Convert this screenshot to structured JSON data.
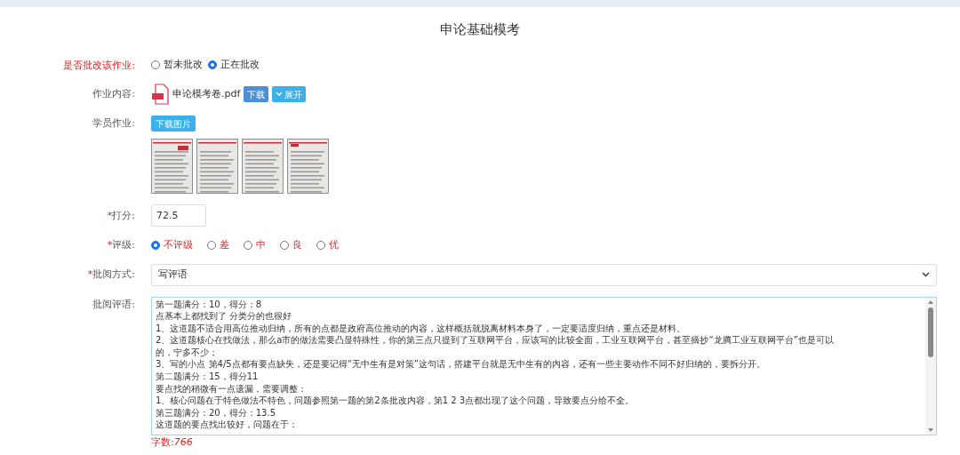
{
  "title": "申论基础模考",
  "grading_status": {
    "label": "是否批改该作业:",
    "emphasized": true,
    "options": [
      {
        "label": "暂未批改",
        "selected": false
      },
      {
        "label": "正在批改",
        "selected": true
      }
    ]
  },
  "assignment": {
    "label": "作业内容:",
    "file_name": "申论模考卷.pdf",
    "download_button": "下载",
    "expand_button": "展开"
  },
  "student_work": {
    "label": "学员作业:",
    "download_button": "下载图片"
  },
  "score": {
    "required_mark": "*",
    "label": "打分:",
    "value": "72.5"
  },
  "rating": {
    "required_mark": "*",
    "label": "评级:",
    "options": [
      {
        "label": "不评级",
        "selected": true
      },
      {
        "label": "差",
        "selected": false
      },
      {
        "label": "中",
        "selected": false
      },
      {
        "label": "良",
        "selected": false
      },
      {
        "label": "优",
        "selected": false
      }
    ]
  },
  "review_method": {
    "required_mark": "*",
    "label": "批阅方式:",
    "value": "写评语"
  },
  "comment": {
    "label": "批阅评语:",
    "lines": [
      "第一题满分：10，得分：8",
      "点基本上都找到了 分类分的也很好",
      "1、这道题不适合用高位推动归纳，所有的点都是政府高位推动的内容，这样概括就脱离材料本身了，一定要适度归纳，重点还是材料。",
      "2、这道题核心在找做法，那么a市的做法需要凸显特殊性，你的第三点只提到了互联网平台，应该写的比较全面，工业互联网平台，甚至摘抄“龙腾工业互联网平台”也是可以",
      "的，宁多不少；",
      "3、写的小点 第4/5点都有要点缺失，还是要记得“无中生有是对策”这句话，搭建平台就是无中生有的内容，还有一些主要动作不同不好归纳的，要拆分开。",
      "第二题满分：15，得分11",
      "要点找的稍微有一点遗漏，需要调整：",
      "1、核心问题在于特色做法不特色，问题参照第一题的第2条批改内容，第1 2 3点都出现了这个问题，导致要点分给不全。",
      "第三题满分：20，得分：13.5",
      "这道题的要点找出较好，问题在于："
    ],
    "word_count": "字数:766"
  }
}
